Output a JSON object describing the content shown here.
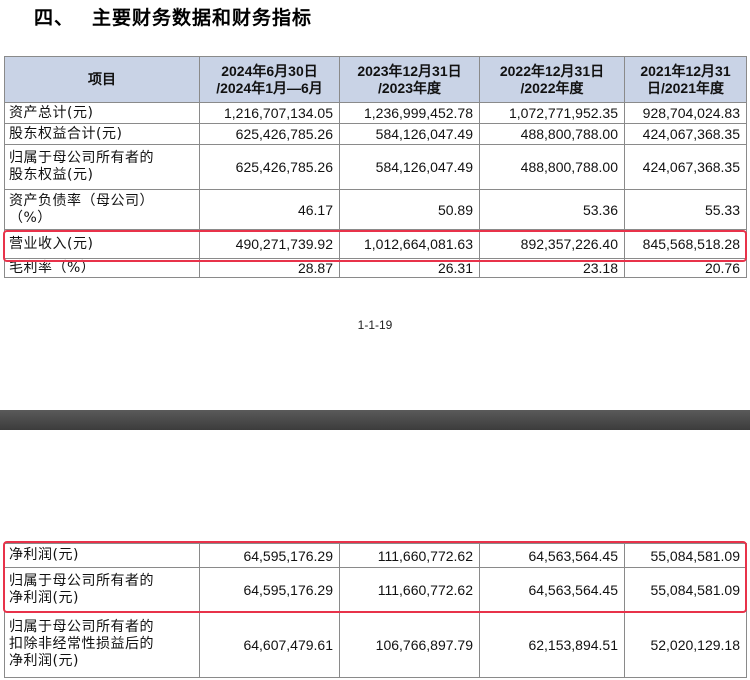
{
  "section_heading": {
    "number": "四、",
    "title": "主要财务数据和财务指标"
  },
  "table_top": {
    "headers": [
      "项目",
      "2024年6月30日\n/2024年1月—6月",
      "2023年12月31日\n/2023年度",
      "2022年12月31日\n/2022年度",
      "2021年12月31\n日/2021年度"
    ],
    "rows": [
      {
        "label": "资产总计(元)",
        "values": [
          "1,216,707,134.05",
          "1,236,999,452.78",
          "1,072,771,952.35",
          "928,704,024.83"
        ]
      },
      {
        "label": "股东权益合计(元)",
        "values": [
          "625,426,785.26",
          "584,126,047.49",
          "488,800,788.00",
          "424,067,368.35"
        ]
      },
      {
        "label": "归属于母公司所有者的\n股东权益(元)",
        "values": [
          "625,426,785.26",
          "584,126,047.49",
          "488,800,788.00",
          "424,067,368.35"
        ]
      },
      {
        "label": "资产负债率（母公司）\n（%）",
        "values": [
          "46.17",
          "50.89",
          "53.36",
          "55.33"
        ]
      },
      {
        "label": "营业收入(元)",
        "values": [
          "490,271,739.92",
          "1,012,664,081.63",
          "892,357,226.40",
          "845,568,518.28"
        ]
      },
      {
        "label": "毛利率（%）",
        "values": [
          "28.87",
          "26.31",
          "23.18",
          "20.76"
        ]
      }
    ]
  },
  "page_number": "1-1-19",
  "table_bottom": {
    "rows": [
      {
        "label": "净利润(元)",
        "values": [
          "64,595,176.29",
          "111,660,772.62",
          "64,563,564.45",
          "55,084,581.09"
        ]
      },
      {
        "label": "归属于母公司所有者的\n净利润(元)",
        "values": [
          "64,595,176.29",
          "111,660,772.62",
          "64,563,564.45",
          "55,084,581.09"
        ]
      },
      {
        "label": "归属于母公司所有者的\n扣除非经常性损益后的\n净利润(元)",
        "values": [
          "64,607,479.61",
          "106,766,897.79",
          "62,153,894.51",
          "52,020,129.18"
        ]
      }
    ]
  },
  "colors": {
    "header_bg": "#c9d3e6",
    "highlight": "#e8324a",
    "page_break": "#4a4a4a"
  }
}
